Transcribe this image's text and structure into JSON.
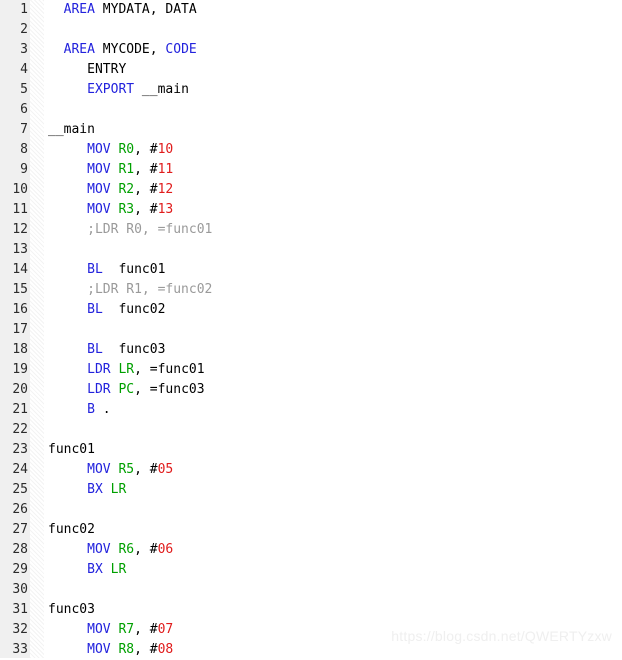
{
  "editor": {
    "language": "ARM Assembly",
    "first_line": 1,
    "last_line": 33,
    "line_height_px": 20,
    "colors": {
      "background": "#ffffff",
      "gutter_background": "#f0f0f0",
      "gutter_text": "#2b2b2b",
      "keyword": "#2222dd",
      "register": "#00a000",
      "number": "#e01b1b",
      "plain": "#000000",
      "comment": "#9a9a9a",
      "watermark": "#efefef"
    }
  },
  "watermark": {
    "text": "https://blog.csdn.net/QWERTYzxw"
  },
  "lines": [
    {
      "n": "1",
      "tokens": [
        {
          "t": "plain",
          "v": "  "
        },
        {
          "t": "key",
          "v": "AREA"
        },
        {
          "t": "plain",
          "v": " MYDATA, DATA"
        }
      ]
    },
    {
      "n": "2",
      "tokens": []
    },
    {
      "n": "3",
      "tokens": [
        {
          "t": "plain",
          "v": "  "
        },
        {
          "t": "key",
          "v": "AREA"
        },
        {
          "t": "plain",
          "v": " MYCODE, "
        },
        {
          "t": "key",
          "v": "CODE"
        }
      ]
    },
    {
      "n": "4",
      "tokens": [
        {
          "t": "plain",
          "v": "     "
        },
        {
          "t": "plain",
          "v": "ENTRY"
        }
      ]
    },
    {
      "n": "5",
      "tokens": [
        {
          "t": "plain",
          "v": "     "
        },
        {
          "t": "key",
          "v": "EXPORT"
        },
        {
          "t": "plain",
          "v": " __main"
        }
      ]
    },
    {
      "n": "6",
      "tokens": []
    },
    {
      "n": "7",
      "tokens": [
        {
          "t": "plain",
          "v": "__main"
        }
      ]
    },
    {
      "n": "8",
      "tokens": [
        {
          "t": "plain",
          "v": "     "
        },
        {
          "t": "key",
          "v": "MOV"
        },
        {
          "t": "plain",
          "v": " "
        },
        {
          "t": "reg",
          "v": "R0"
        },
        {
          "t": "plain",
          "v": ", #"
        },
        {
          "t": "num",
          "v": "10"
        }
      ]
    },
    {
      "n": "9",
      "tokens": [
        {
          "t": "plain",
          "v": "     "
        },
        {
          "t": "key",
          "v": "MOV"
        },
        {
          "t": "plain",
          "v": " "
        },
        {
          "t": "reg",
          "v": "R1"
        },
        {
          "t": "plain",
          "v": ", #"
        },
        {
          "t": "num",
          "v": "11"
        }
      ]
    },
    {
      "n": "10",
      "tokens": [
        {
          "t": "plain",
          "v": "     "
        },
        {
          "t": "key",
          "v": "MOV"
        },
        {
          "t": "plain",
          "v": " "
        },
        {
          "t": "reg",
          "v": "R2"
        },
        {
          "t": "plain",
          "v": ", #"
        },
        {
          "t": "num",
          "v": "12"
        }
      ]
    },
    {
      "n": "11",
      "tokens": [
        {
          "t": "plain",
          "v": "     "
        },
        {
          "t": "key",
          "v": "MOV"
        },
        {
          "t": "plain",
          "v": " "
        },
        {
          "t": "reg",
          "v": "R3"
        },
        {
          "t": "plain",
          "v": ", #"
        },
        {
          "t": "num",
          "v": "13"
        }
      ]
    },
    {
      "n": "12",
      "tokens": [
        {
          "t": "plain",
          "v": "     "
        },
        {
          "t": "com",
          "v": ";LDR R0, =func01"
        }
      ]
    },
    {
      "n": "13",
      "tokens": []
    },
    {
      "n": "14",
      "tokens": [
        {
          "t": "plain",
          "v": "     "
        },
        {
          "t": "key",
          "v": "BL"
        },
        {
          "t": "plain",
          "v": "  func01"
        }
      ]
    },
    {
      "n": "15",
      "tokens": [
        {
          "t": "plain",
          "v": "     "
        },
        {
          "t": "com",
          "v": ";LDR R1, =func02"
        }
      ]
    },
    {
      "n": "16",
      "tokens": [
        {
          "t": "plain",
          "v": "     "
        },
        {
          "t": "key",
          "v": "BL"
        },
        {
          "t": "plain",
          "v": "  func02"
        }
      ]
    },
    {
      "n": "17",
      "tokens": []
    },
    {
      "n": "18",
      "tokens": [
        {
          "t": "plain",
          "v": "     "
        },
        {
          "t": "key",
          "v": "BL"
        },
        {
          "t": "plain",
          "v": "  func03"
        }
      ]
    },
    {
      "n": "19",
      "tokens": [
        {
          "t": "plain",
          "v": "     "
        },
        {
          "t": "key",
          "v": "LDR"
        },
        {
          "t": "plain",
          "v": " "
        },
        {
          "t": "reg",
          "v": "LR"
        },
        {
          "t": "plain",
          "v": ", =func01"
        }
      ]
    },
    {
      "n": "20",
      "tokens": [
        {
          "t": "plain",
          "v": "     "
        },
        {
          "t": "key",
          "v": "LDR"
        },
        {
          "t": "plain",
          "v": " "
        },
        {
          "t": "reg",
          "v": "PC"
        },
        {
          "t": "plain",
          "v": ", =func03"
        }
      ]
    },
    {
      "n": "21",
      "tokens": [
        {
          "t": "plain",
          "v": "     "
        },
        {
          "t": "key",
          "v": "B"
        },
        {
          "t": "plain",
          "v": " ."
        }
      ]
    },
    {
      "n": "22",
      "tokens": []
    },
    {
      "n": "23",
      "tokens": [
        {
          "t": "plain",
          "v": "func01"
        }
      ]
    },
    {
      "n": "24",
      "tokens": [
        {
          "t": "plain",
          "v": "     "
        },
        {
          "t": "key",
          "v": "MOV"
        },
        {
          "t": "plain",
          "v": " "
        },
        {
          "t": "reg",
          "v": "R5"
        },
        {
          "t": "plain",
          "v": ", #"
        },
        {
          "t": "num",
          "v": "05"
        }
      ]
    },
    {
      "n": "25",
      "tokens": [
        {
          "t": "plain",
          "v": "     "
        },
        {
          "t": "key",
          "v": "BX"
        },
        {
          "t": "plain",
          "v": " "
        },
        {
          "t": "reg",
          "v": "LR"
        }
      ]
    },
    {
      "n": "26",
      "tokens": []
    },
    {
      "n": "27",
      "tokens": [
        {
          "t": "plain",
          "v": "func02"
        }
      ]
    },
    {
      "n": "28",
      "tokens": [
        {
          "t": "plain",
          "v": "     "
        },
        {
          "t": "key",
          "v": "MOV"
        },
        {
          "t": "plain",
          "v": " "
        },
        {
          "t": "reg",
          "v": "R6"
        },
        {
          "t": "plain",
          "v": ", #"
        },
        {
          "t": "num",
          "v": "06"
        }
      ]
    },
    {
      "n": "29",
      "tokens": [
        {
          "t": "plain",
          "v": "     "
        },
        {
          "t": "key",
          "v": "BX"
        },
        {
          "t": "plain",
          "v": " "
        },
        {
          "t": "reg",
          "v": "LR"
        }
      ]
    },
    {
      "n": "30",
      "tokens": []
    },
    {
      "n": "31",
      "tokens": [
        {
          "t": "plain",
          "v": "func03"
        }
      ]
    },
    {
      "n": "32",
      "tokens": [
        {
          "t": "plain",
          "v": "     "
        },
        {
          "t": "key",
          "v": "MOV"
        },
        {
          "t": "plain",
          "v": " "
        },
        {
          "t": "reg",
          "v": "R7"
        },
        {
          "t": "plain",
          "v": ", #"
        },
        {
          "t": "num",
          "v": "07"
        }
      ]
    },
    {
      "n": "33",
      "tokens": [
        {
          "t": "plain",
          "v": "     "
        },
        {
          "t": "key",
          "v": "MOV"
        },
        {
          "t": "plain",
          "v": " "
        },
        {
          "t": "reg",
          "v": "R8"
        },
        {
          "t": "plain",
          "v": ", #"
        },
        {
          "t": "num",
          "v": "08"
        }
      ]
    }
  ]
}
